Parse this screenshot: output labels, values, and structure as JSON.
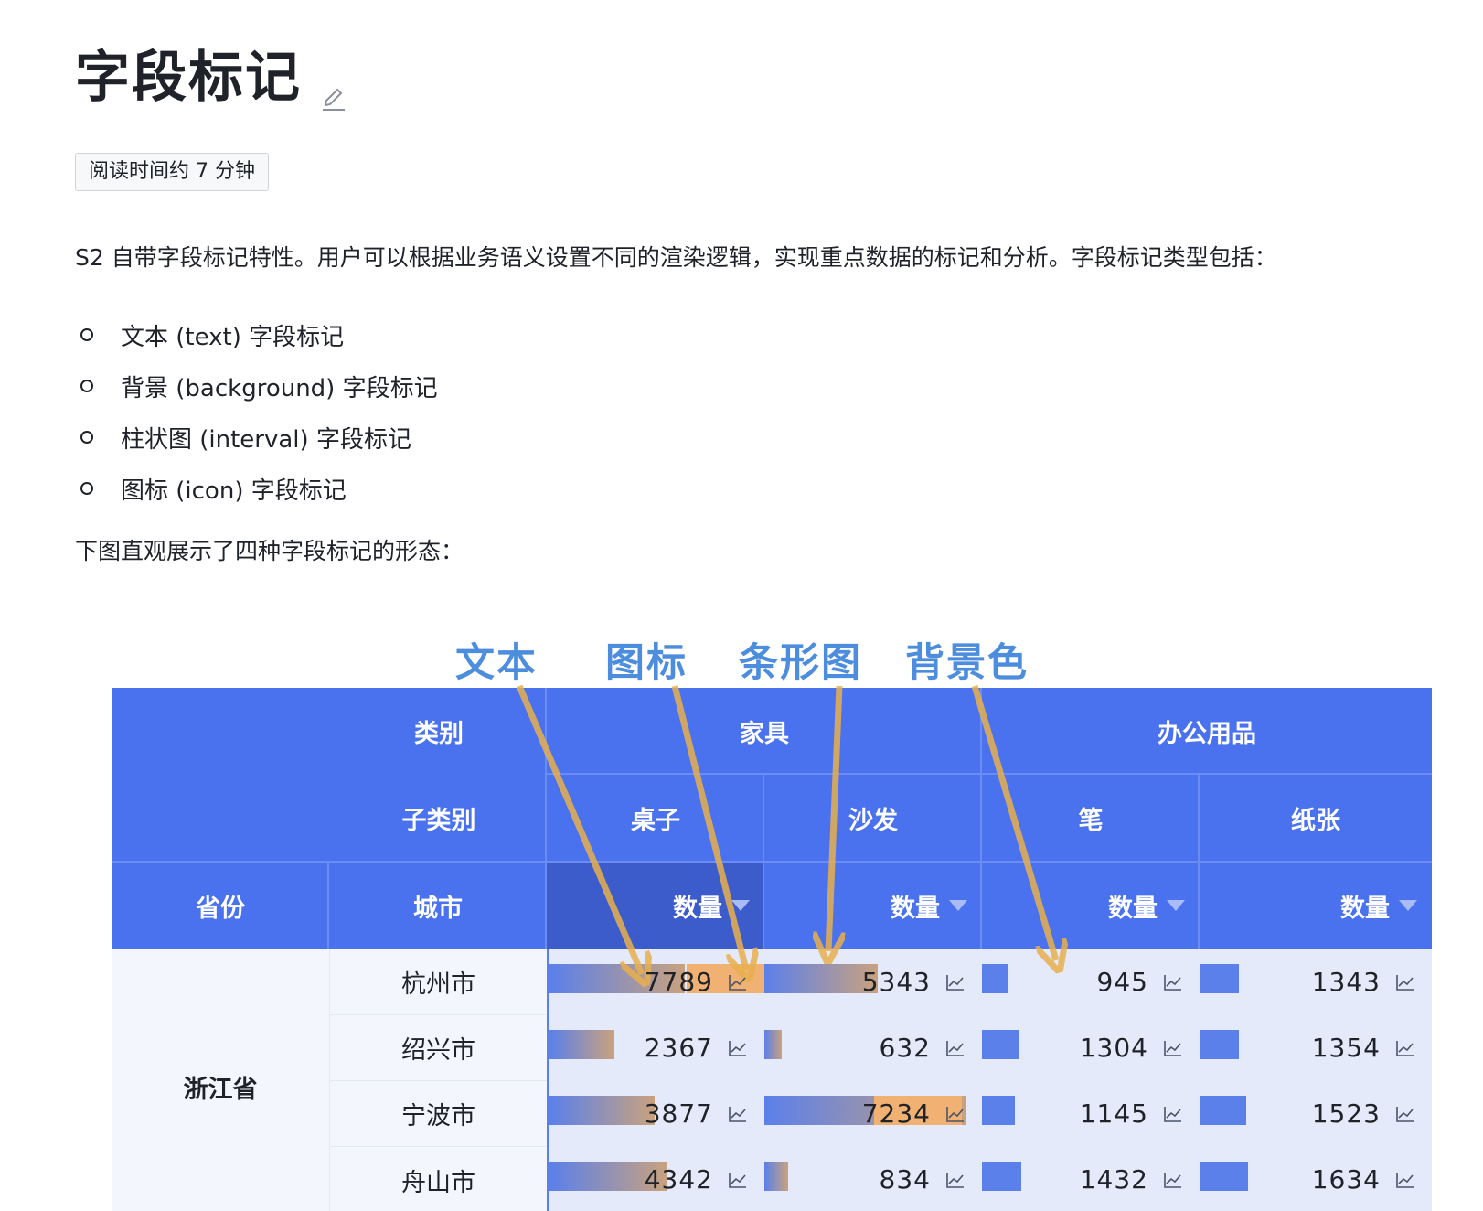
{
  "page": {
    "title": "字段标记",
    "read_time": "阅读时间约 7 分钟",
    "intro": "S2 自带字段标记特性。用户可以根据业务语义设置不同的渲染逻辑，实现重点数据的标记和分析。字段标记类型包括：",
    "list": [
      "文本 (text) 字段标记",
      "背景 (background) 字段标记",
      "柱状图 (interval) 字段标记",
      "图标 (icon) 字段标记"
    ],
    "caption": "下图直观展示了四种字段标记的形态："
  },
  "figure": {
    "annotations": [
      "文本",
      "图标",
      "条形图",
      "背景色"
    ],
    "annotation_color": "#4d8ddd",
    "arrow_color": "#e8b04e",
    "header": {
      "corner_row1": "类别",
      "corner_row2": "子类别",
      "province": "省份",
      "city": "城市",
      "categories": [
        "家具",
        "办公用品"
      ],
      "subcategories": [
        "桌子",
        "沙发",
        "笔",
        "纸张"
      ],
      "measure": "数量"
    },
    "province": "浙江省",
    "cities": [
      "杭州市",
      "绍兴市",
      "宁波市",
      "舟山市"
    ],
    "values": [
      [
        "7789",
        "5343",
        "945",
        "1343"
      ],
      [
        "2367",
        "632",
        "1304",
        "1354"
      ],
      [
        "3877",
        "7234",
        "1145",
        "1523"
      ],
      [
        "4342",
        "834",
        "1432",
        "1634"
      ]
    ],
    "bar_fractions": [
      [
        0.63,
        0.52,
        0.12,
        0.17
      ],
      [
        0.3,
        0.08,
        0.17,
        0.17
      ],
      [
        0.49,
        0.93,
        0.15,
        0.2
      ],
      [
        0.55,
        0.11,
        0.18,
        0.21
      ]
    ],
    "header_color": "#4a72ee",
    "bar_color": "#5b80ea",
    "highlight_color": "#f1b173"
  }
}
